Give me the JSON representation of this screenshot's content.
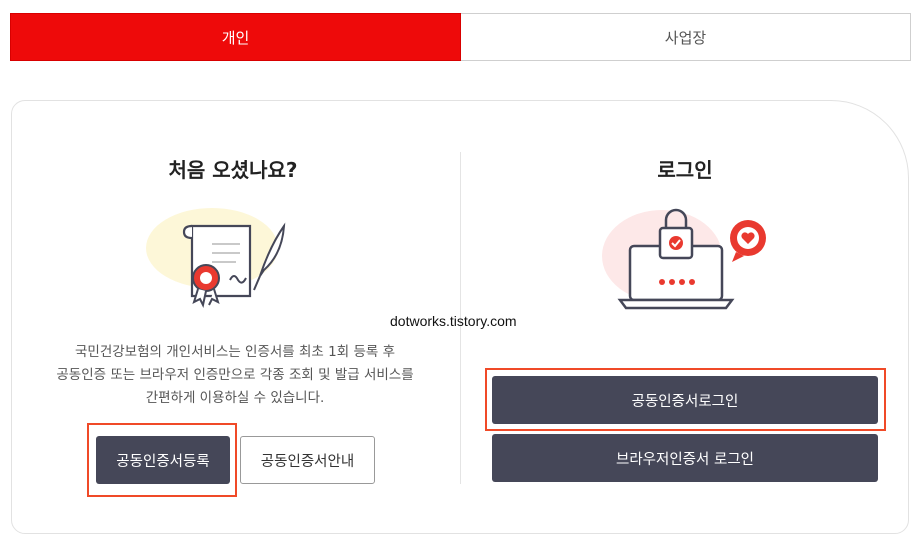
{
  "tabs": [
    {
      "label": "개인",
      "active": true
    },
    {
      "label": "사업장",
      "active": false
    }
  ],
  "left": {
    "title": "처음 오셨나요?",
    "illustration_icon": "certificate-icon",
    "description_lines": [
      "국민건강보험의 개인서비스는 인증서를 최초 1회 등록 후",
      "공동인증 또는 브라우저 인증만으로 각종 조회 및 발급 서비스를",
      "간편하게 이용하실 수 있습니다."
    ],
    "register_button": "공동인증서등록",
    "guide_button": "공동인증서안내"
  },
  "right": {
    "title": "로그인",
    "illustration_icon": "laptop-lock-icon",
    "cert_login_button": "공동인증서로그인",
    "browser_login_button": "브라우저인증서 로그인"
  },
  "watermark": "dotworks.tistory.com",
  "colors": {
    "accent_red": "#ee0a0a",
    "button_dark": "#454758",
    "highlight": "#f04a28"
  }
}
